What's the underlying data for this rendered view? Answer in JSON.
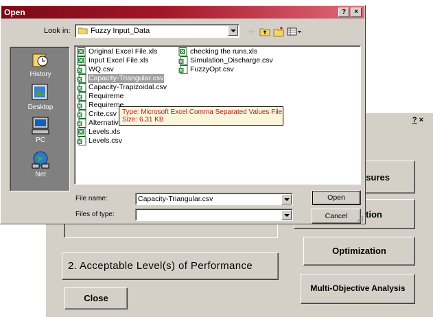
{
  "background_window": {
    "help_glyph": "?",
    "close_glyph": "×",
    "buttons": {
      "measures": "asures",
      "function": "tion",
      "optimization": "Optimization",
      "multi_objective": "Multi-Objective Analysis",
      "acceptable": "2.  Acceptable Level(s) of Performance",
      "close": "Close"
    }
  },
  "open_dialog": {
    "title": "Open",
    "help_glyph": "?",
    "close_glyph": "×",
    "look_in_label": "Look in:",
    "look_in_value": "Fuzzy Input_Data",
    "places": [
      "History",
      "Desktop",
      "PC",
      "Net"
    ],
    "files": [
      {
        "name": "Original Excel File.xls",
        "icon": "excel-xls-icon"
      },
      {
        "name": "Input Excel File.xls",
        "icon": "excel-xls-icon"
      },
      {
        "name": "WQ.csv",
        "icon": "csv-file-icon"
      },
      {
        "name": "Capacity-Triangular.csv",
        "icon": "csv-file-icon",
        "selected": true
      },
      {
        "name": "Capacity-Trapizoidal.csv",
        "icon": "csv-file-icon"
      },
      {
        "name": "Requireme",
        "icon": "csv-file-icon"
      },
      {
        "name": "Requireme",
        "icon": "csv-file-icon"
      },
      {
        "name": "Crite.csv",
        "icon": "csv-file-icon"
      },
      {
        "name": "Alternatives.csv",
        "icon": "csv-file-icon"
      },
      {
        "name": "Levels.xls",
        "icon": "excel-xls-icon"
      },
      {
        "name": "Levels.csv",
        "icon": "csv-file-icon"
      },
      {
        "name": "checking the runs.xls",
        "icon": "excel-xls-icon"
      },
      {
        "name": "Simulation_Discharge.csv",
        "icon": "csv-file-icon"
      },
      {
        "name": "FuzzyOpt.csv",
        "icon": "csv-file-icon"
      }
    ],
    "tooltip": {
      "type": "Type: Microsoft Excel Comma Separated Values File",
      "size": "Size: 6.31 KB"
    },
    "file_name_label": "File name:",
    "file_name_value": "Capacity-Triangular.csv",
    "files_of_type_label": "Files of type:",
    "files_of_type_value": "",
    "open_button": "Open",
    "cancel_button": "Cancel"
  }
}
